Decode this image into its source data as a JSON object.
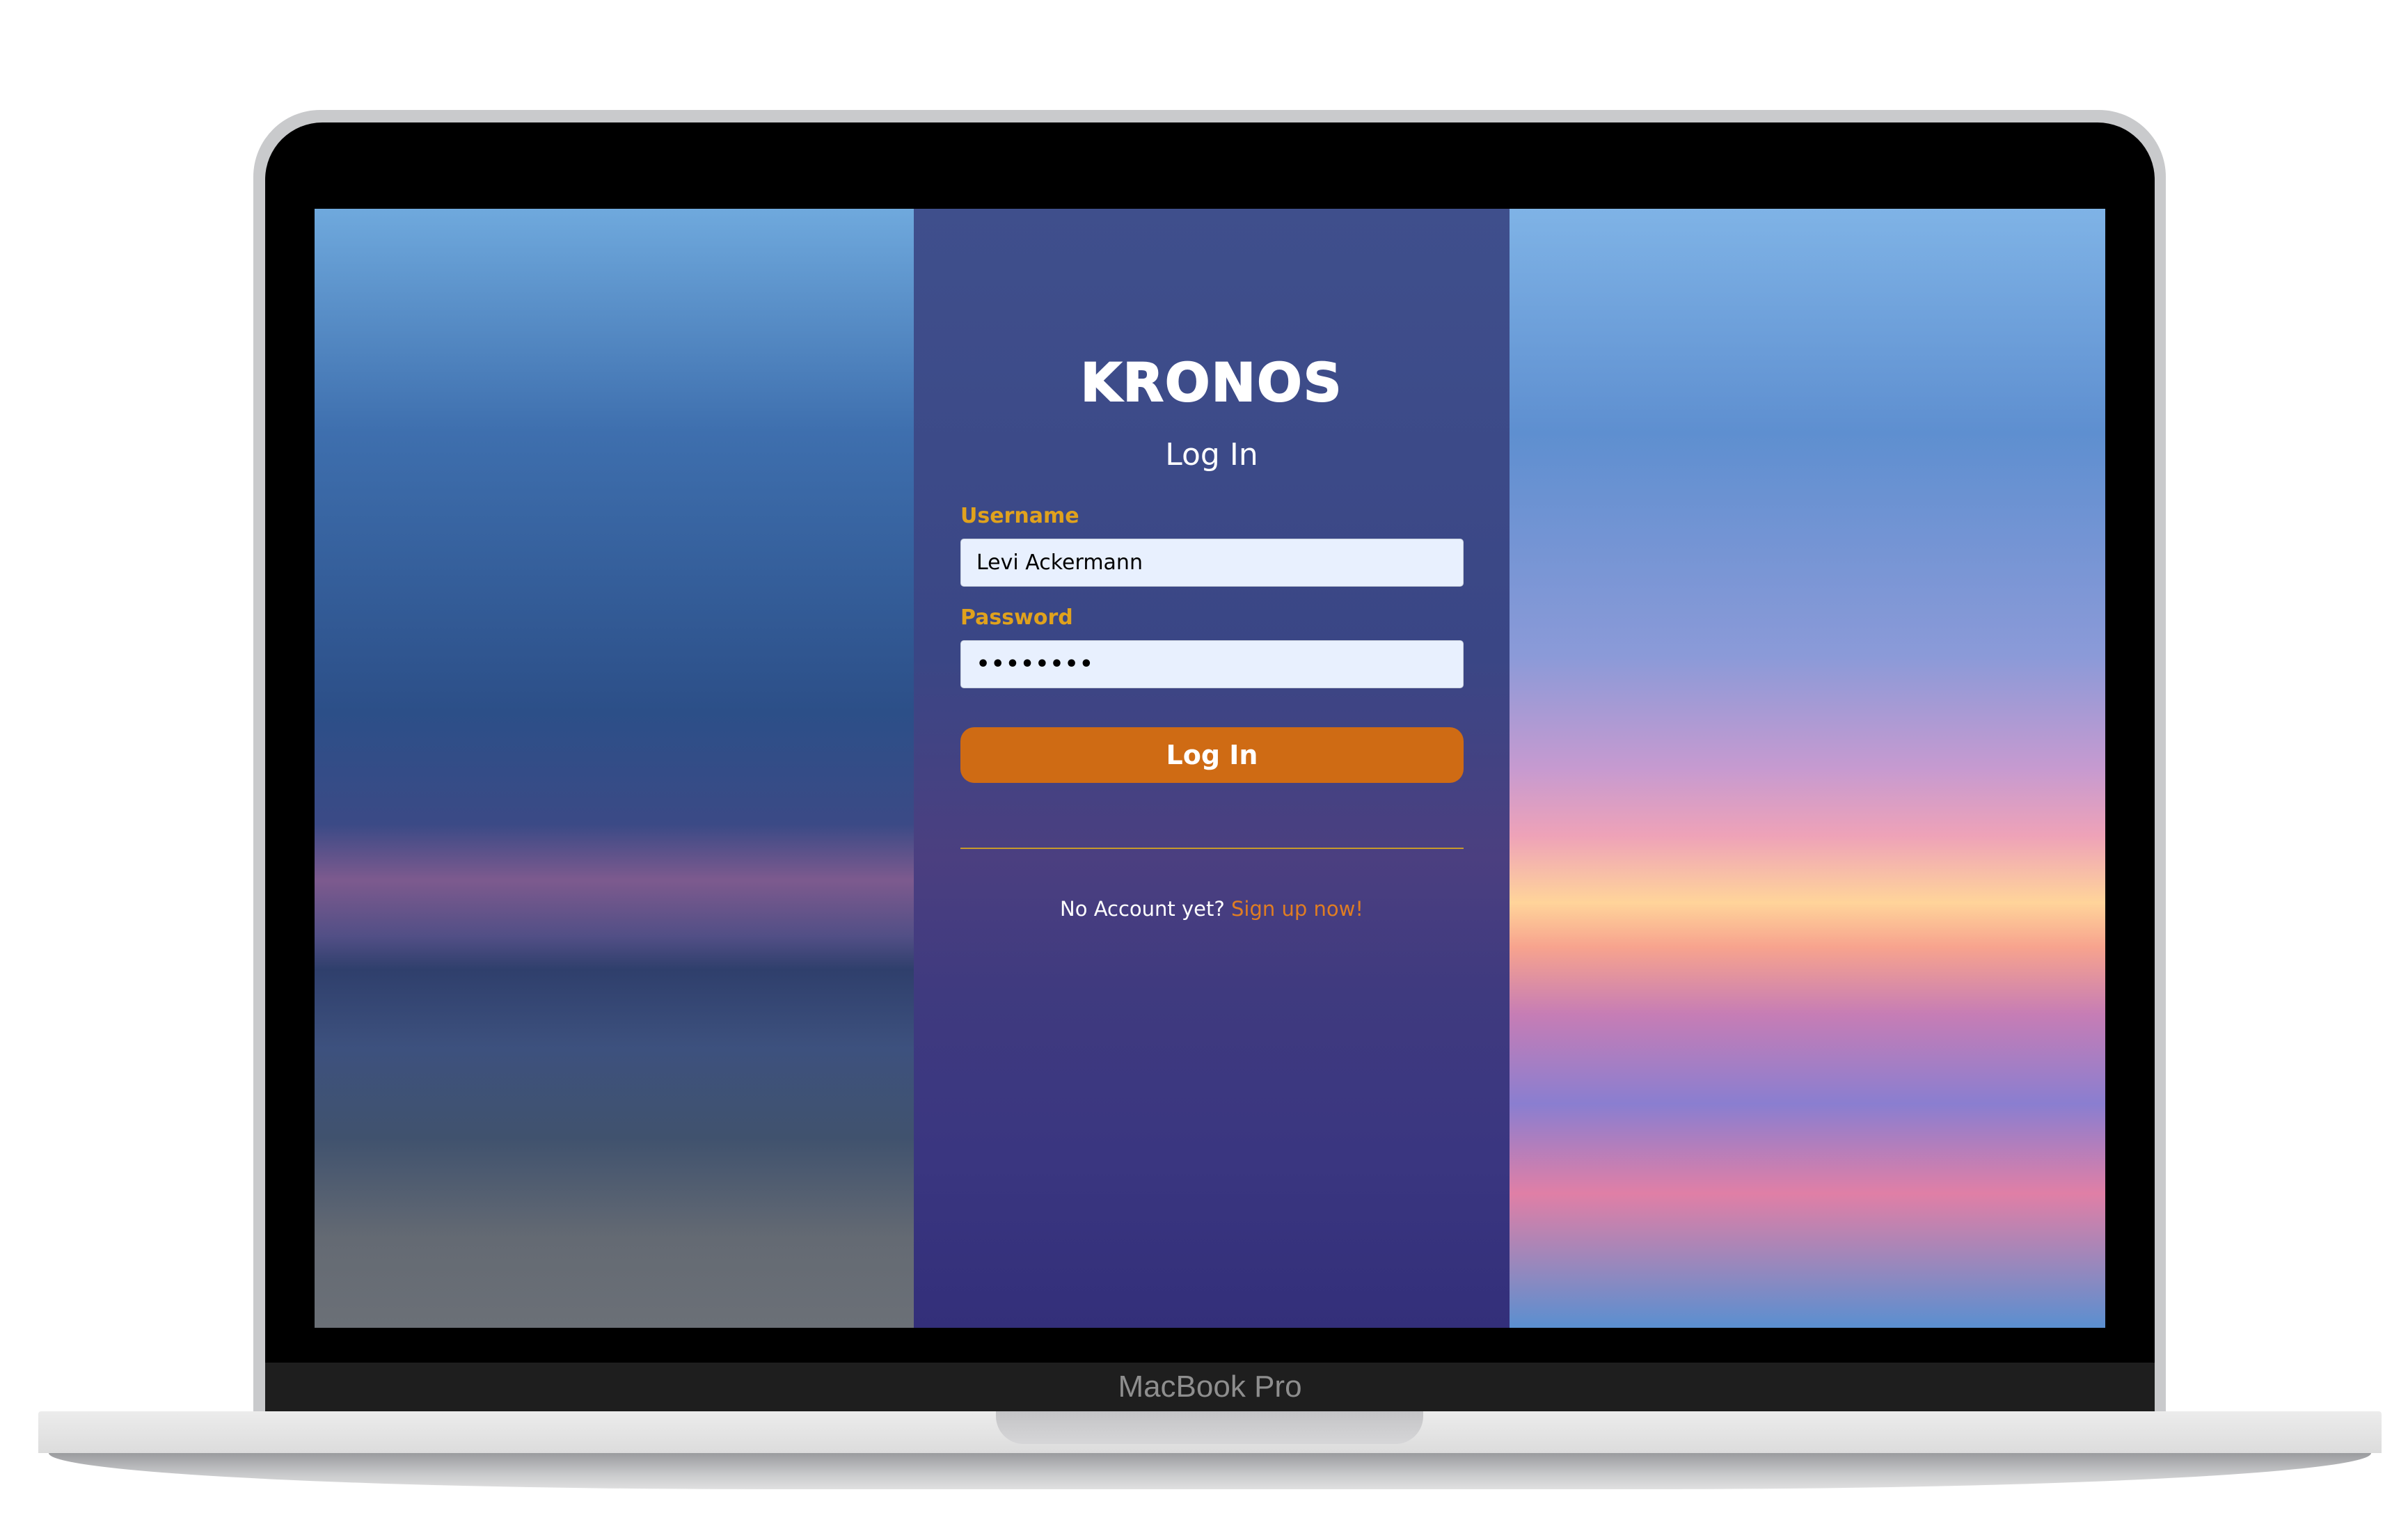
{
  "device": {
    "label": "MacBook Pro"
  },
  "login": {
    "logo": "KRONOS",
    "title": "Log In",
    "username_label": "Username",
    "username_value": "Levi Ackermann",
    "password_label": "Password",
    "password_value": "••••••••",
    "submit_label": "Log In",
    "footer_text": "No Account yet?",
    "signup_link": "Sign up now!"
  },
  "colors": {
    "accent": "#cf6b14",
    "label": "#e0a21d",
    "link": "#e07d22"
  }
}
